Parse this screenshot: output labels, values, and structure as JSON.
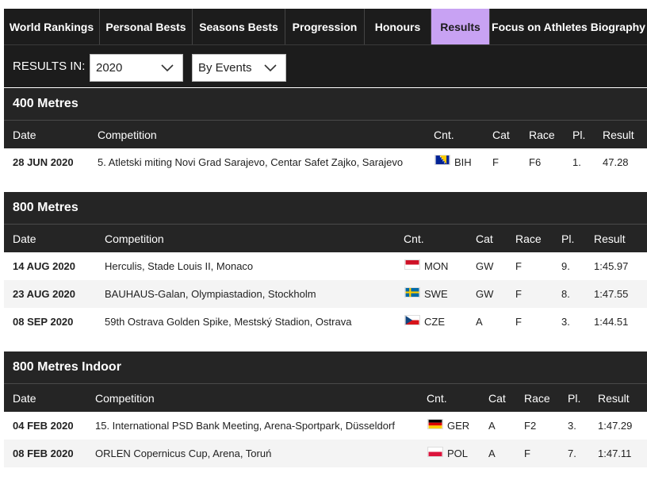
{
  "tabs": [
    {
      "label": "World Rankings"
    },
    {
      "label": "Personal Bests"
    },
    {
      "label": "Seasons Bests"
    },
    {
      "label": "Progression"
    },
    {
      "label": "Honours"
    },
    {
      "label": "Results",
      "active": true
    },
    {
      "label": "Focus on Athletes Biography"
    }
  ],
  "filter": {
    "label": "RESULTS IN:",
    "year": "2020",
    "group_by": "By Events"
  },
  "columns": {
    "date": "Date",
    "competition": "Competition",
    "country": "Cnt.",
    "category": "Cat",
    "race": "Race",
    "place": "Pl.",
    "result": "Result"
  },
  "sections": [
    {
      "title": "400 Metres",
      "rows": [
        {
          "date": "28 JUN 2020",
          "competition": "5. Atletski miting Novi Grad Sarajevo, Centar Safet Zajko, Sarajevo",
          "country": "BIH",
          "category": "F",
          "race": "F6",
          "place": "1.",
          "result": "47.28"
        }
      ]
    },
    {
      "title": "800 Metres",
      "rows": [
        {
          "date": "14 AUG 2020",
          "competition": "Herculis, Stade Louis II, Monaco",
          "country": "MON",
          "category": "GW",
          "race": "F",
          "place": "9.",
          "result": "1:45.97"
        },
        {
          "date": "23 AUG 2020",
          "competition": "BAUHAUS-Galan, Olympiastadion, Stockholm",
          "country": "SWE",
          "category": "GW",
          "race": "F",
          "place": "8.",
          "result": "1:47.55"
        },
        {
          "date": "08 SEP 2020",
          "competition": "59th Ostrava Golden Spike, Mestský Stadion, Ostrava",
          "country": "CZE",
          "category": "A",
          "race": "F",
          "place": "3.",
          "result": "1:44.51"
        }
      ]
    },
    {
      "title": "800 Metres Indoor",
      "rows": [
        {
          "date": "04 FEB 2020",
          "competition": "15. International PSD Bank Meeting, Arena-Sportpark, Düsseldorf",
          "country": "GER",
          "category": "A",
          "race": "F2",
          "place": "3.",
          "result": "1:47.29"
        },
        {
          "date": "08 FEB 2020",
          "competition": "ORLEN Copernicus Cup, Arena, Toruń",
          "country": "POL",
          "category": "A",
          "race": "F",
          "place": "7.",
          "result": "1:47.11"
        }
      ]
    }
  ]
}
